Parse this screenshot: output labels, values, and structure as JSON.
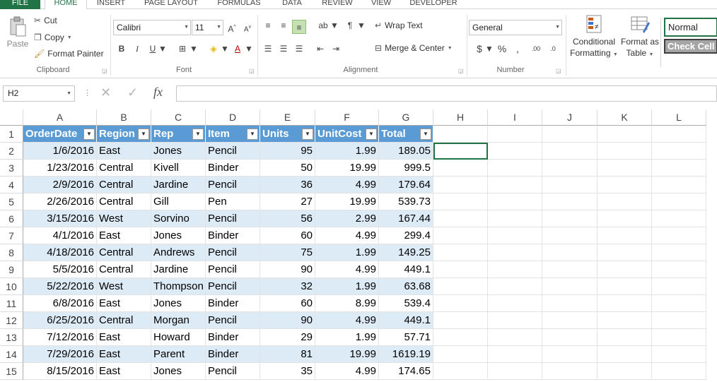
{
  "ribbon_tabs": [
    "FILE",
    "HOME",
    "INSERT",
    "PAGE LAYOUT",
    "FORMULAS",
    "DATA",
    "REVIEW",
    "VIEW",
    "DEVELOPER"
  ],
  "clipboard": {
    "paste": "Paste",
    "cut": "Cut",
    "copy": "Copy",
    "format_painter": "Format Painter",
    "label": "Clipboard"
  },
  "font": {
    "name": "Calibri",
    "size": "11",
    "label": "Font"
  },
  "alignment": {
    "wrap_text": "Wrap Text",
    "merge_center": "Merge & Center",
    "label": "Alignment"
  },
  "number": {
    "format": "General",
    "label": "Number"
  },
  "styles": {
    "conditional": "Conditional",
    "formatting": "Formatting",
    "format_as": "Format as",
    "table": "Table",
    "normal": "Normal",
    "check_cell": "Check Cell"
  },
  "formula_bar": {
    "name_box": "H2",
    "fx": "fx",
    "value": ""
  },
  "columns": [
    "A",
    "B",
    "C",
    "D",
    "E",
    "F",
    "G",
    "H",
    "I",
    "J",
    "K",
    "L"
  ],
  "table_headers": [
    "OrderDate",
    "Region",
    "Rep",
    "Item",
    "Units",
    "UnitCost",
    "Total"
  ],
  "rows": [
    [
      "1/6/2016",
      "East",
      "Jones",
      "Pencil",
      "95",
      "1.99",
      "189.05"
    ],
    [
      "1/23/2016",
      "Central",
      "Kivell",
      "Binder",
      "50",
      "19.99",
      "999.5"
    ],
    [
      "2/9/2016",
      "Central",
      "Jardine",
      "Pencil",
      "36",
      "4.99",
      "179.64"
    ],
    [
      "2/26/2016",
      "Central",
      "Gill",
      "Pen",
      "27",
      "19.99",
      "539.73"
    ],
    [
      "3/15/2016",
      "West",
      "Sorvino",
      "Pencil",
      "56",
      "2.99",
      "167.44"
    ],
    [
      "4/1/2016",
      "East",
      "Jones",
      "Binder",
      "60",
      "4.99",
      "299.4"
    ],
    [
      "4/18/2016",
      "Central",
      "Andrews",
      "Pencil",
      "75",
      "1.99",
      "149.25"
    ],
    [
      "5/5/2016",
      "Central",
      "Jardine",
      "Pencil",
      "90",
      "4.99",
      "449.1"
    ],
    [
      "5/22/2016",
      "West",
      "Thompson",
      "Pencil",
      "32",
      "1.99",
      "63.68"
    ],
    [
      "6/8/2016",
      "East",
      "Jones",
      "Binder",
      "60",
      "8.99",
      "539.4"
    ],
    [
      "6/25/2016",
      "Central",
      "Morgan",
      "Pencil",
      "90",
      "4.99",
      "449.1"
    ],
    [
      "7/12/2016",
      "East",
      "Howard",
      "Binder",
      "29",
      "1.99",
      "57.71"
    ],
    [
      "7/29/2016",
      "East",
      "Parent",
      "Binder",
      "81",
      "19.99",
      "1619.19"
    ],
    [
      "8/15/2016",
      "East",
      "Jones",
      "Pencil",
      "35",
      "4.99",
      "174.65"
    ]
  ],
  "colors": {
    "accent": "#217346",
    "table_header": "#5b9bd5",
    "band": "#ddebf7"
  }
}
